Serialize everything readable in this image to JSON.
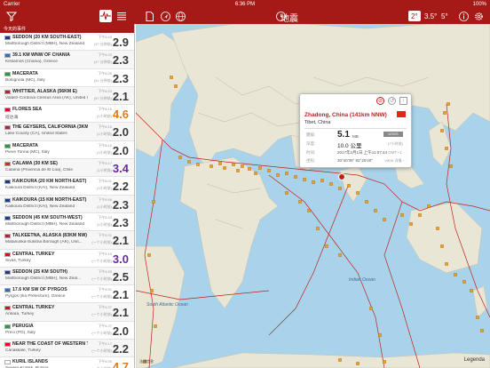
{
  "status_bar": {
    "carrier": "Carrier",
    "time": "6:36 PM",
    "battery": "100%"
  },
  "toolbar": {
    "title": "地震",
    "magnitudes": [
      "2°",
      "3.5°",
      "5°"
    ],
    "selected_magnitude": "2°",
    "icons": [
      "filter-icon",
      "seismograph-icon",
      "list-icon",
      "document-icon",
      "location-arrow-icon",
      "globe-icon",
      "clock-icon",
      "info-icon",
      "settings-icon"
    ]
  },
  "sidebar": {
    "section_title": "今天的事件",
    "events": [
      {
        "title": "SEDDON (20 KM SOUTH-EAST)",
        "subtitle": "Marlborough District (MBH), New Zealand",
        "time": "下午6:43",
        "ago": "(37 分钟前)",
        "mag": "2.9",
        "color": "#3a3a3a",
        "flag": "nz"
      },
      {
        "title": "39.1 KM WNW OF CHANIA",
        "subtitle": "Kissamos (Chania), Greece",
        "time": "下午6:33",
        "ago": "(47 分钟前)",
        "mag": "2.3",
        "color": "#3a3a3a",
        "flag": "gr"
      },
      {
        "title": "MACERATA",
        "subtitle": "Bolognola (MC), Italy",
        "time": "下午6:29",
        "ago": "(51 分钟前)",
        "mag": "2.3",
        "color": "#3a3a3a",
        "flag": "it"
      },
      {
        "title": "WHITTIER, ALASKA (56KM E)",
        "subtitle": "Valdez-Cordova Census Area (AK), United States",
        "time": "下午6:23",
        "ago": "(57 分钟前)",
        "mag": "2.1",
        "color": "#3a3a3a",
        "flag": "us"
      },
      {
        "title": "FLORES SEA",
        "subtitle": "班达海",
        "time": "下午6:16",
        "ago": "(1小时前)",
        "mag": "4.6",
        "color": "#e07a17",
        "flag": "id"
      },
      {
        "title": "THE GEYSERS, CALIFORNIA (3KM...",
        "subtitle": "Lake County (CA), United States",
        "time": "下午6:15",
        "ago": "(1小时前)",
        "mag": "2.0",
        "color": "#3a3a3a",
        "flag": "us"
      },
      {
        "title": "MACERATA",
        "subtitle": "Pieve Torina (MC), Italy",
        "time": "下午6:15",
        "ago": "(1小时前)",
        "mag": "2.0",
        "color": "#3a3a3a",
        "flag": "it"
      },
      {
        "title": "CALAMA (30 KM SE)",
        "subtitle": "Calama (Provincia de El Loa), Chile",
        "time": "下午6:17",
        "ago": "(1小时前)",
        "mag": "3.4",
        "color": "#6a2a9a",
        "flag": "cl"
      },
      {
        "title": "KAIKOURA (20 KM NORTH-EAST)",
        "subtitle": "Kaikoura District (KAI), New Zealand",
        "time": "下午6:01",
        "ago": "(1小时前)",
        "mag": "2.2",
        "color": "#3a3a3a",
        "flag": "nz"
      },
      {
        "title": "KAIKOURA (15 KM NORTH-EAST)",
        "subtitle": "Kaikoura District (KAI), New Zealand",
        "time": "下午5:56",
        "ago": "(1小时前)",
        "mag": "2.3",
        "color": "#3a3a3a",
        "flag": "nz"
      },
      {
        "title": "SEDDON (45 KM SOUTH-WEST)",
        "subtitle": "Marlborough District (MBH), New Zealand",
        "time": "下午5:43",
        "ago": "(1小时前)",
        "mag": "2.3",
        "color": "#3a3a3a",
        "flag": "nz"
      },
      {
        "title": "TALKEETNA, ALASKA (83KM NW)",
        "subtitle": "Matanuska-Susitna Borough (AK), Unit...",
        "time": "下午5:31",
        "ago": "(一个小时前)",
        "mag": "2.1",
        "color": "#3a3a3a",
        "flag": "us"
      },
      {
        "title": "CENTRAL TURKEY",
        "subtitle": "Sivas, Turkey",
        "time": "下午5:19",
        "ago": "(一个小时前)",
        "mag": "3.0",
        "color": "#6a2a9a",
        "flag": "tr"
      },
      {
        "title": "SEDDON (25 KM SOUTH)",
        "subtitle": "Marlborough District (MBH), New Zeal...",
        "time": "下午4:53",
        "ago": "(一个小时前)",
        "mag": "2.5",
        "color": "#3a3a3a",
        "flag": "nz"
      },
      {
        "title": "17.6 KM SW OF PYRGOS",
        "subtitle": "Pyrgos (Ilia Prefecture), Greece",
        "time": "下午4:51",
        "ago": "(一个小时前)",
        "mag": "2.1",
        "color": "#3a3a3a",
        "flag": "gr"
      },
      {
        "title": "CENTRAL TURKEY",
        "subtitle": "Ankara, Turkey",
        "time": "下午4:37",
        "ago": "(一个小时前)",
        "mag": "2.1",
        "color": "#3a3a3a",
        "flag": "tr"
      },
      {
        "title": "PERUGIA",
        "subtitle": "Preci (PG), Italy",
        "time": "下午4:27",
        "ago": "(一个小时前)",
        "mag": "2.0",
        "color": "#3a3a3a",
        "flag": "it"
      },
      {
        "title": "NEAR THE COAST OF WESTERN T...",
        "subtitle": "Canakkale, Turkey",
        "time": "下午4:17",
        "ago": "(一个小时前)",
        "mag": "2.2",
        "color": "#3a3a3a",
        "flag": "tr"
      },
      {
        "title": "KURIL ISLANDS",
        "subtitle": "Severo-Kurilsk, Russia",
        "time": "下午4:09",
        "ago": "(一个小时前)",
        "mag": "4.7",
        "color": "#e07a17",
        "flag": "ru"
      }
    ]
  },
  "map": {
    "ocean_labels": [
      "Indian Ocean",
      "South Atlantic Ocean"
    ],
    "legend_label": "Legenda",
    "attribution": "法律信息",
    "quake_color": "#f0a020",
    "plate_color": "#c0201b"
  },
  "popup": {
    "place": "Zhadong, China (141km NNW)",
    "region": "Tibet, China",
    "mag_label": "震级:",
    "mag": "5.1",
    "mag_type": "MB",
    "source": "USGS",
    "depth_label": "深度:",
    "depth": "10.0 公里",
    "depth_note": "(7小时前)",
    "time_label": "时间:",
    "time": "2017年2月1日 上午11:07:44",
    "time_tz": "GMT+1",
    "coords_label": "坐标:",
    "coords": "30°40'36\"  82°20'40\"",
    "more_label": "VIEW 详情 ›"
  }
}
